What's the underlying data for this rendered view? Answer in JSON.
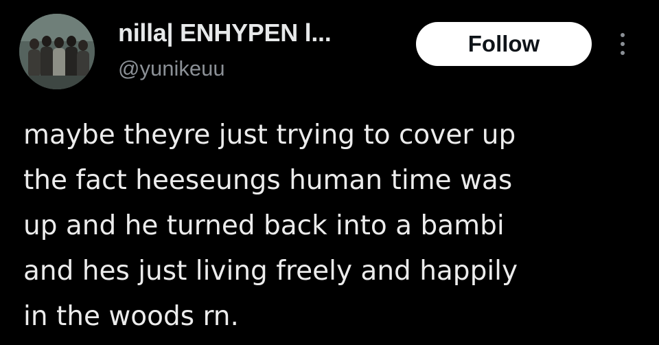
{
  "author": {
    "display_name": "nilla| ENHYPEN l...",
    "handle": "@yunikeuu",
    "avatar_icon": "group-photo-avatar"
  },
  "actions": {
    "follow_label": "Follow",
    "more_icon": "more-vertical-icon"
  },
  "tweet": {
    "lines": [
      "maybe theyre just trying to cover up",
      "the fact heeseungs human time was",
      "up and he turned back into a bambi",
      "and hes just living freely and happily",
      "in the woods rn."
    ]
  },
  "colors": {
    "background": "#000000",
    "text_primary": "#e7e9ea",
    "text_secondary": "#8b9096",
    "follow_bg": "#ffffff",
    "follow_text": "#0f1419"
  }
}
